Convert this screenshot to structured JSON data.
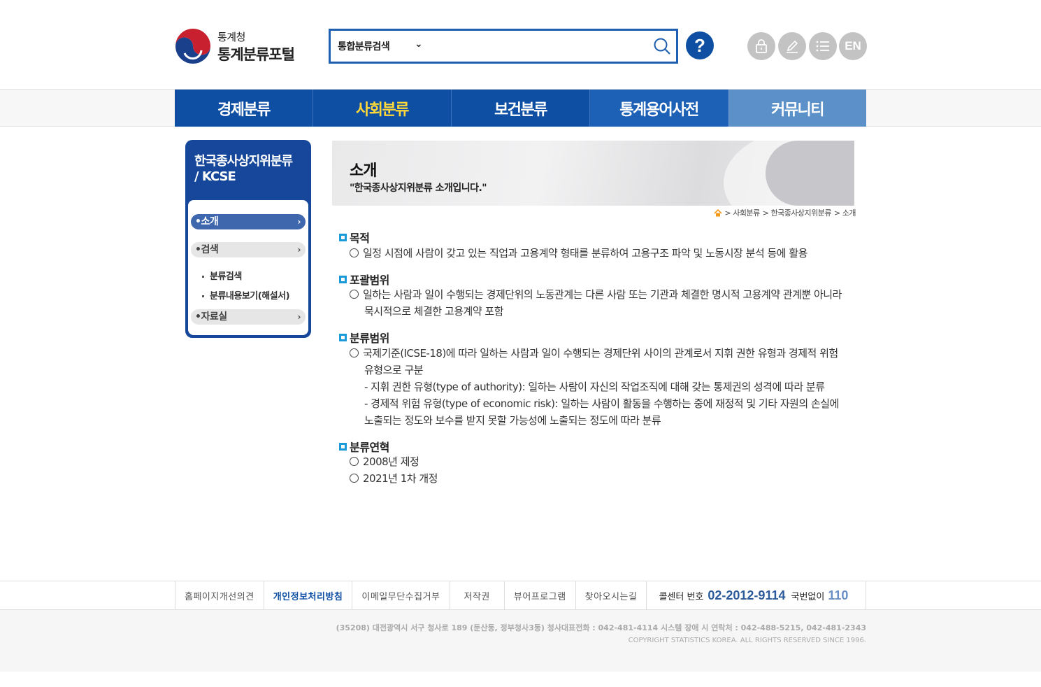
{
  "header": {
    "logo_sub": "통계청",
    "logo_main": "통계분류포털",
    "search": {
      "select_label": "통합분류검색",
      "placeholder": "",
      "value": ""
    },
    "help_label": "?",
    "utility": {
      "en_label": "EN"
    }
  },
  "gnb": {
    "items": [
      {
        "label": "경제분류"
      },
      {
        "label": "사회분류"
      },
      {
        "label": "보건분류"
      },
      {
        "label": "통계용어사전"
      },
      {
        "label": "커뮤니티"
      }
    ]
  },
  "lnb": {
    "title_line1": "한국종사상지위분류",
    "title_line2": "/ KCSE",
    "menu": [
      {
        "label": "•소개",
        "arrow": "›"
      },
      {
        "label": "•검색",
        "arrow": "›"
      },
      {
        "label": "•자료실",
        "arrow": "›"
      }
    ],
    "sub": [
      {
        "label": "분류검색"
      },
      {
        "label": "분류내용보기(해설서)"
      }
    ]
  },
  "banner": {
    "title": "소개",
    "desc": "\"한국종사상지위분류 소개입니다.\""
  },
  "breadcrumb": {
    "items": [
      "> 사회분류",
      "> 한국종사상지위분류",
      "> 소개"
    ]
  },
  "content": {
    "sections": [
      {
        "heading": "목적",
        "lines": [
          "일정 시점에 사람이 갖고 있는 직업과 고용계약 형태를 분류하여 고용구조 파악 및 노동시장 분석 등에 활용"
        ]
      },
      {
        "heading": "포괄범위",
        "lines": [
          "일하는 사람과 일이 수행되는 경제단위의 노동관계는 다른 사람 또는 기관과 체결한 명시적 고용계약 관계뿐 아니라",
          "묵시적으로 체결한 고용계약 포함"
        ]
      },
      {
        "heading": "분류범위",
        "lines": [
          "국제기준(ICSE-18)에 따라 일하는 사람과 일이 수행되는 경제단위 사이의 관계로서 지휘 권한 유형과 경제적 위험",
          "유형으로 구분",
          "- 지휘 권한 유형(type of authority): 일하는 사람이 자신의 작업조직에 대해 갖는 통제권의 성격에 따라 분류",
          "- 경제적 위험 유형(type of economic risk): 일하는 사람이 활동을 수행하는 중에 재정적 및 기타 자원의 손실에",
          "노출되는 정도와 보수를 받지 못할 가능성에 노출되는 정도에 따라 분류"
        ]
      },
      {
        "heading": "분류연혁",
        "lines": [
          "2008년 제정",
          "2021년 1차 개정"
        ]
      }
    ]
  },
  "footer": {
    "links": [
      {
        "label": "홈페이지개선의견"
      },
      {
        "label": "개인정보처리방침"
      },
      {
        "label": "이메일무단수집거부"
      },
      {
        "label": "저작권"
      },
      {
        "label": "뷰어프로그램"
      },
      {
        "label": "찾아오시는길"
      }
    ],
    "callcenter_label": "콜센터 번호",
    "callcenter_number": "02-2012-9114",
    "callcenter_label2": "국번없이",
    "callcenter_number2": "110",
    "address": "(35208) 대전광역시 서구 청사로 189 (둔산동, 정부청사3동) 청사대표전화 : 042-481-4114 시스템 장애 시 연락처 : 042-488-5215, 042-481-2343",
    "copyright": "COPYRIGHT STATISTICS KOREA. ALL RIGHTS RESERVED SINCE 1996."
  },
  "colors": {
    "primary": "#0e4fa3",
    "active_menu": "#ffd83a",
    "section_bullet": "#1a9ad6"
  }
}
